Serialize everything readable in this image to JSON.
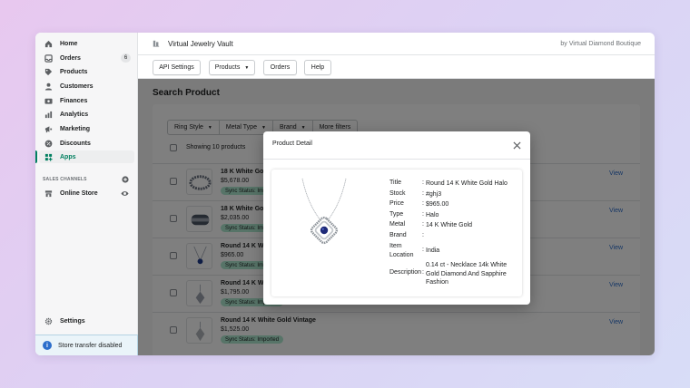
{
  "sidebar": {
    "items": [
      {
        "label": "Home",
        "icon": "home-icon"
      },
      {
        "label": "Orders",
        "icon": "orders-icon",
        "badge": "6"
      },
      {
        "label": "Products",
        "icon": "tag-icon"
      },
      {
        "label": "Customers",
        "icon": "person-icon"
      },
      {
        "label": "Finances",
        "icon": "finances-icon"
      },
      {
        "label": "Analytics",
        "icon": "analytics-icon"
      },
      {
        "label": "Marketing",
        "icon": "marketing-icon"
      },
      {
        "label": "Discounts",
        "icon": "discount-icon"
      },
      {
        "label": "Apps",
        "icon": "apps-icon",
        "active": true
      }
    ],
    "sales_channels_label": "SALES CHANNELS",
    "online_store_label": "Online Store",
    "settings_label": "Settings",
    "store_transfer_label": "Store transfer disabled"
  },
  "topbar": {
    "app_title": "Virtual Jewelry Vault",
    "byline": "by Virtual Diamond Boutique"
  },
  "toolbar": {
    "api_settings": "API Settings",
    "products": "Products",
    "orders": "Orders",
    "help": "Help"
  },
  "page": {
    "title": "Search Product",
    "filters": [
      "Ring Style",
      "Metal Type",
      "Brand",
      "More filters"
    ],
    "showing": "Showing 10 products",
    "view_label": "View",
    "rows": [
      {
        "name": "18 K White Gol",
        "price": "$5,678.00",
        "sync": "Sync Status: Im"
      },
      {
        "name": "18 K White Gol",
        "price": "$2,035.00",
        "sync": "Sync Status: Im"
      },
      {
        "name": "Round 14 K Wh",
        "price": "$965.00",
        "sync": "Sync Status: Im"
      },
      {
        "name": "Round 14 K Wh",
        "price": "$1,795.00",
        "sync": "Sync Status: Imported"
      },
      {
        "name": "Round 14 K White Gold Vintage",
        "price": "$1,525.00",
        "sync": "Sync Status: Imported"
      }
    ]
  },
  "modal": {
    "title": "Product Detail",
    "fields": [
      {
        "label": "Title",
        "value": "Round 14 K White Gold Halo"
      },
      {
        "label": "Stock",
        "value": "#ghj3"
      },
      {
        "label": "Price",
        "value": "$965.00"
      },
      {
        "label": "Type",
        "value": "Halo"
      },
      {
        "label": "Metal",
        "value": "14 K White Gold"
      },
      {
        "label": "Brand",
        "value": ""
      },
      {
        "label": "Item Location",
        "value": "India"
      },
      {
        "label": "Description",
        "value": "0.14 ct - Necklace 14k White Gold Diamond And Sapphire Fashion"
      }
    ]
  },
  "colors": {
    "accent": "#008060",
    "link": "#2c6ecb",
    "sync_badge": "#aee9d1"
  }
}
